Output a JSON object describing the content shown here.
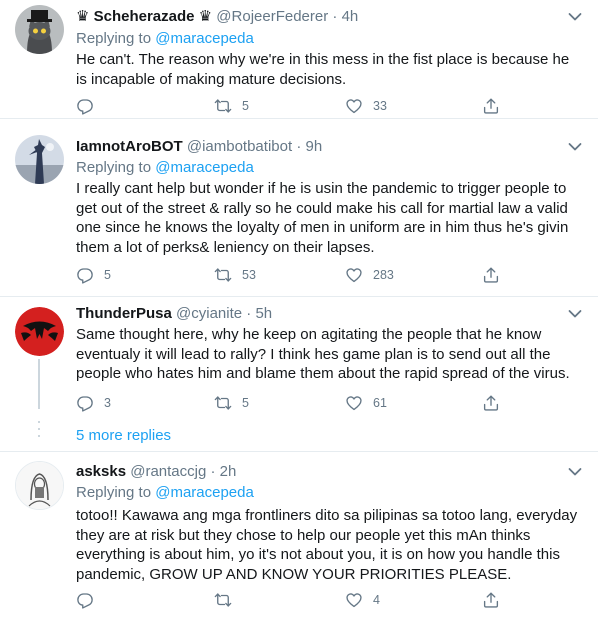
{
  "tweets": [
    {
      "name": "♛ Scheherazade ♛",
      "handle": "@RojeerFederer",
      "sep": "·",
      "time": "4h",
      "replying_prefix": "Replying to",
      "replying_to": "@maracepeda",
      "body": "He can't. The reason why we're in this mess in the fist place is because he is incapable of making mature decisions.",
      "replies": "",
      "retweets": "5",
      "likes": "33"
    },
    {
      "name": "IamnotAroBOT",
      "handle": "@iambotbatibot",
      "sep": "·",
      "time": "9h",
      "replying_prefix": "Replying to",
      "replying_to": "@maracepeda",
      "body": "I really cant help but wonder if he is usin the pandemic to trigger people to get out of the street & rally so he could make his call for martial law a valid one since he knows the loyalty of men in uniform are in him thus he's givin them a lot of perks& leniency on their lapses.",
      "replies": "5",
      "retweets": "53",
      "likes": "283"
    },
    {
      "name": "ThunderPusa",
      "handle": "@cyianite",
      "sep": "·",
      "time": "5h",
      "body": "Same thought here, why he keep on agitating the people that he know eventualy it will lead to rally? I think hes game plan is to send out all the people who hates him and blame them about the rapid spread of the virus.",
      "replies": "3",
      "retweets": "5",
      "likes": "61"
    },
    {
      "name": "asksks",
      "handle": "@rantaccjg",
      "sep": "·",
      "time": "2h",
      "replying_prefix": "Replying to",
      "replying_to": "@maracepeda",
      "body": "totoo!! Kawawa ang mga frontliners dito sa pilipinas sa totoo lang, everyday they are at risk but they chose to help our people yet this mAn thinks everything is about him, yo it's not about you, it is on how you handle this pandemic, GROW UP AND KNOW YOUR PRIORITIES PLEASE.",
      "replies": "",
      "retweets": "",
      "likes": "4"
    }
  ],
  "more_replies": "5 more replies",
  "colors": {
    "link": "#1da1f2",
    "muted": "#657786",
    "text": "#14171a",
    "border": "#e6ecf0"
  },
  "icons": [
    "reply-icon",
    "retweet-icon",
    "like-icon",
    "share-icon",
    "caret-down-icon"
  ]
}
